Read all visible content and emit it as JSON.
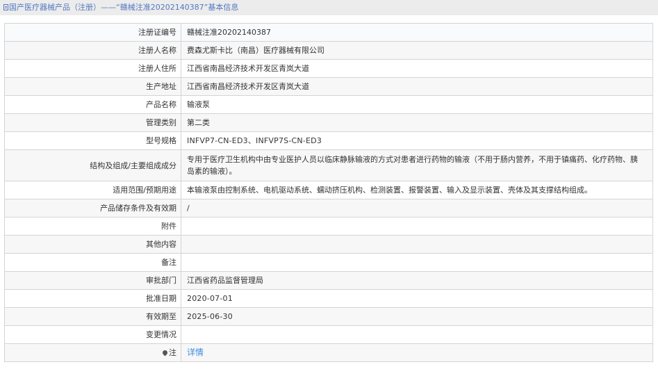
{
  "breadcrumb": {
    "icon": "document-icon",
    "text": "国产医疗器械产品（注册）——“赣械注准20202140387”基本信息"
  },
  "rows": [
    {
      "label": "注册证编号",
      "value": "赣械注准20202140387"
    },
    {
      "label": "注册人名称",
      "value": "费森尤斯卡比（南昌）医疗器械有限公司"
    },
    {
      "label": "注册人住所",
      "value": "江西省南昌经济技术开发区青岚大道"
    },
    {
      "label": "生产地址",
      "value": "江西省南昌经济技术开发区青岚大道"
    },
    {
      "label": "产品名称",
      "value": "输液泵"
    },
    {
      "label": "管理类别",
      "value": "第二类"
    },
    {
      "label": "型号规格",
      "value": "INFVP7-CN-ED3、INFVP7S-CN-ED3"
    },
    {
      "label": "结构及组成/主要组成成分",
      "value": "专用于医疗卫生机构中由专业医护人员以临床静脉输液的方式对患者进行药物的输液（不用于肠内营养，不用于镇痛药、化疗药物、胰岛素的输液）。"
    },
    {
      "label": "适用范围/预期用途",
      "value": "本输液泵由控制系统、电机驱动系统、蠕动挤压机构、检测装置、报警装置、输入及显示装置、壳体及其支撑结构组成。"
    },
    {
      "label": "产品储存条件及有效期",
      "value": "/"
    },
    {
      "label": "附件",
      "value": ""
    },
    {
      "label": "其他内容",
      "value": ""
    },
    {
      "label": "备注",
      "value": ""
    },
    {
      "label": "审批部门",
      "value": "江西省药品监督管理局"
    },
    {
      "label": "批准日期",
      "value": "2020-07-01"
    },
    {
      "label": "有效期至",
      "value": "2025-06-30"
    },
    {
      "label": "变更情况",
      "value": ""
    },
    {
      "label": "注",
      "icon": "pin-icon",
      "value": "详情"
    }
  ]
}
